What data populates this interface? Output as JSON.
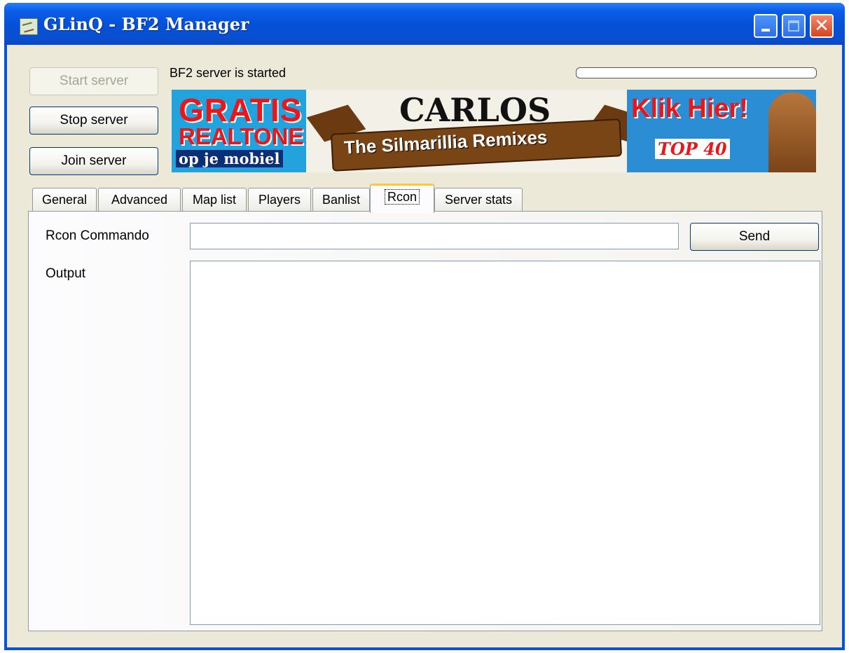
{
  "window": {
    "title": "GLinQ - BF2 Manager"
  },
  "controls": {
    "start_server": "Start server",
    "stop_server": "Stop server",
    "join_server": "Join server"
  },
  "status": {
    "text": "BF2 server is started",
    "progress": 0
  },
  "banner": {
    "gratis": "GRATIS",
    "realtone": "REALTONE!",
    "mobiel": "op je mobiel",
    "carlos": "CARLOS",
    "remixes": "The Silmarillia Remixes",
    "klik": "Klik Hier!",
    "top40": "TOP 40"
  },
  "tabs": [
    "General",
    "Advanced",
    "Map list",
    "Players",
    "Banlist",
    "Rcon",
    "Server stats"
  ],
  "active_tab": "Rcon",
  "rcon": {
    "command_label": "Rcon Commando",
    "command_value": "",
    "send": "Send",
    "output_label": "Output",
    "output_value": ""
  },
  "icons": {
    "app": "app-icon",
    "minimize": "minimize-icon",
    "maximize": "maximize-icon",
    "close": "close-icon"
  },
  "colors": {
    "titlebar": "#0a52d6",
    "window_bg": "#ece9d8",
    "active_tab_accent": "#ffc83c",
    "close_button": "#d5441f"
  }
}
